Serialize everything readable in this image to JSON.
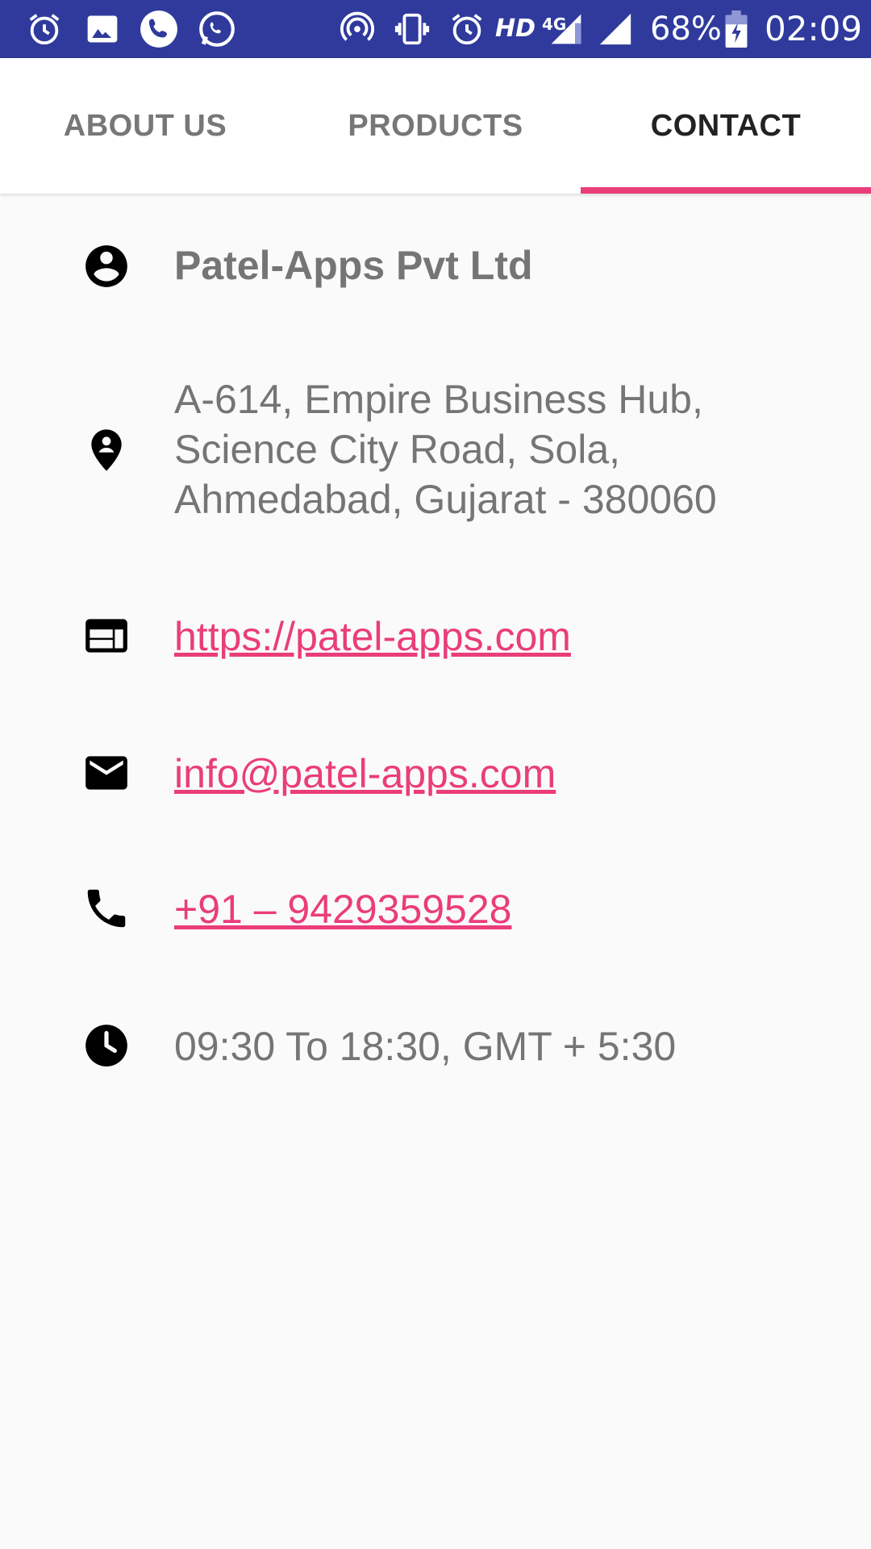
{
  "status_bar": {
    "battery_percent": "68%",
    "time": "02:09",
    "network_hd": "HD",
    "network_4g": "4G",
    "left_icons": [
      "alarm-icon",
      "gallery-icon",
      "phone-call-icon",
      "whatsapp-icon"
    ],
    "right_icons": [
      "hotspot-icon",
      "vibrate-icon",
      "alarm-icon",
      "signal-4g-icon",
      "signal-icon",
      "battery-charging-icon"
    ],
    "background_color": "#2f3a9c"
  },
  "tabs": [
    {
      "label": "ABOUT US",
      "active": false
    },
    {
      "label": "PRODUCTS",
      "active": false
    },
    {
      "label": "CONTACT",
      "active": true
    }
  ],
  "accent_color": "#ea3d7a",
  "contact": {
    "company": {
      "icon": "account-circle-icon",
      "text": "Patel-Apps Pvt Ltd"
    },
    "address": {
      "icon": "location-pin-icon",
      "lines": [
        "A-614, Empire Business Hub,",
        "Science City Road, Sola,",
        "Ahmedabad, Gujarat - 380060"
      ]
    },
    "website": {
      "icon": "web-icon",
      "text": "https://patel-apps.com"
    },
    "email": {
      "icon": "mail-icon",
      "text": "info@patel-apps.com"
    },
    "phone": {
      "icon": "phone-icon",
      "text": "+91 – 9429359528"
    },
    "hours": {
      "icon": "clock-icon",
      "text": "09:30 To 18:30, GMT + 5:30"
    }
  }
}
